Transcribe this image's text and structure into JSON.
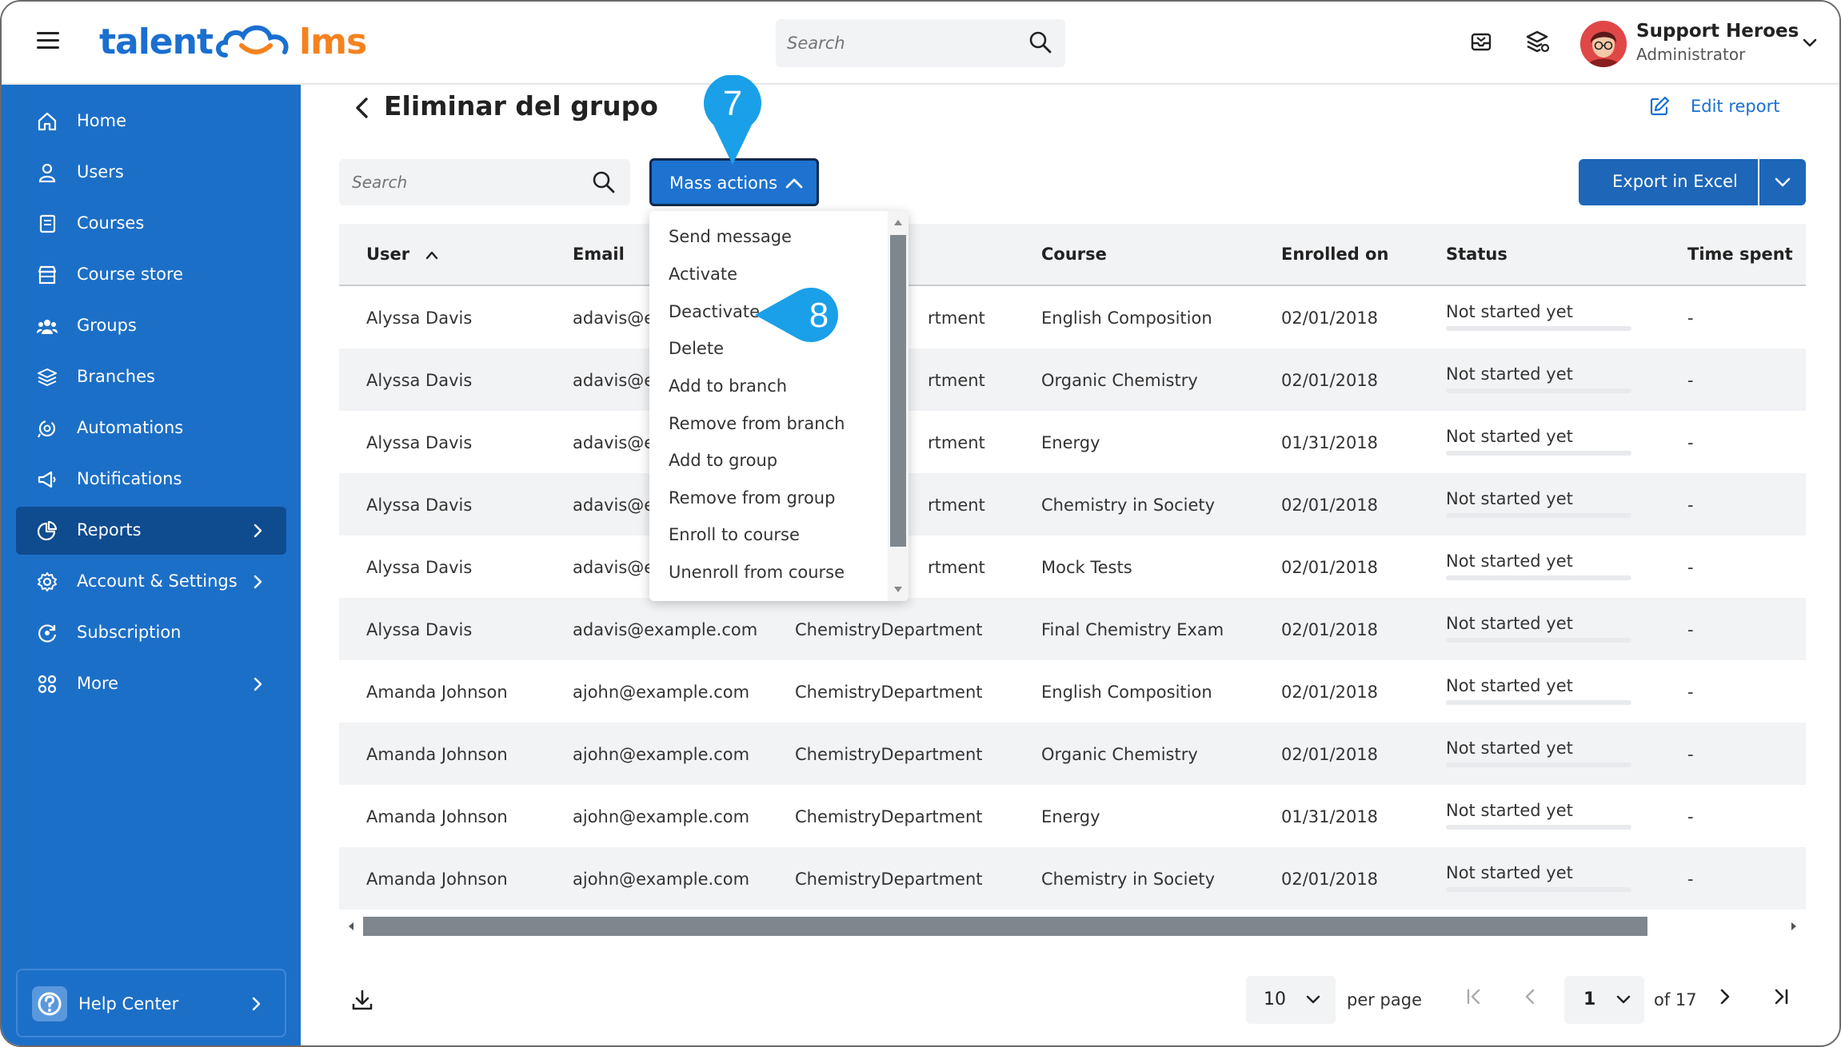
{
  "brand": {
    "logo_left": "talent",
    "logo_right": "lms",
    "primary": "#1c6fc7",
    "accent": "#f5821f",
    "callout": "#1aa0e8"
  },
  "header": {
    "menu_icon": "hamburger-icon",
    "search_placeholder": "Search",
    "icons": [
      "inbox-icon",
      "layers-settings-icon"
    ],
    "user_name": "Support Heroes",
    "user_role": "Administrator"
  },
  "sidebar": {
    "items": [
      {
        "label": "Home",
        "icon": "home-icon"
      },
      {
        "label": "Users",
        "icon": "user-icon"
      },
      {
        "label": "Courses",
        "icon": "book-icon"
      },
      {
        "label": "Course store",
        "icon": "store-icon"
      },
      {
        "label": "Groups",
        "icon": "groups-icon"
      },
      {
        "label": "Branches",
        "icon": "layers-icon"
      },
      {
        "label": "Automations",
        "icon": "automation-icon"
      },
      {
        "label": "Notifications",
        "icon": "megaphone-icon"
      },
      {
        "label": "Reports",
        "icon": "pie-chart-icon",
        "active": true
      },
      {
        "label": "Account & Settings",
        "icon": "gear-icon"
      },
      {
        "label": "Subscription",
        "icon": "subscription-icon"
      },
      {
        "label": "More",
        "icon": "grid-icon"
      }
    ],
    "help_label": "Help Center"
  },
  "page": {
    "title": "Eliminar del grupo",
    "edit_report": "Edit report",
    "search_placeholder": "Search",
    "mass_actions": "Mass actions",
    "export_label": "Export in Excel"
  },
  "table": {
    "columns": [
      "User",
      "Email",
      "Course",
      "Enrolled on",
      "Status",
      "Time spent"
    ],
    "rows": [
      {
        "user": "Alyssa Davis",
        "email": "adavis@e",
        "branch": "rtment",
        "course": "English Composition",
        "enrolled": "02/01/2018",
        "status": "Not started yet",
        "time": "-"
      },
      {
        "user": "Alyssa Davis",
        "email": "adavis@e",
        "branch": "rtment",
        "course": "Organic Chemistry",
        "enrolled": "02/01/2018",
        "status": "Not started yet",
        "time": "-"
      },
      {
        "user": "Alyssa Davis",
        "email": "adavis@e",
        "branch": "rtment",
        "course": "Energy",
        "enrolled": "01/31/2018",
        "status": "Not started yet",
        "time": "-"
      },
      {
        "user": "Alyssa Davis",
        "email": "adavis@e",
        "branch": "rtment",
        "course": "Chemistry in Society",
        "enrolled": "02/01/2018",
        "status": "Not started yet",
        "time": "-"
      },
      {
        "user": "Alyssa Davis",
        "email": "adavis@e",
        "branch": "rtment",
        "course": "Mock Tests",
        "enrolled": "02/01/2018",
        "status": "Not started yet",
        "time": "-"
      },
      {
        "user": "Alyssa Davis",
        "email": "adavis@example.com",
        "branch": "ChemistryDepartment",
        "course": "Final Chemistry Exam",
        "enrolled": "02/01/2018",
        "status": "Not started yet",
        "time": "-"
      },
      {
        "user": "Amanda Johnson",
        "email": "ajohn@example.com",
        "branch": "ChemistryDepartment",
        "course": "English Composition",
        "enrolled": "02/01/2018",
        "status": "Not started yet",
        "time": "-"
      },
      {
        "user": "Amanda Johnson",
        "email": "ajohn@example.com",
        "branch": "ChemistryDepartment",
        "course": "Organic Chemistry",
        "enrolled": "02/01/2018",
        "status": "Not started yet",
        "time": "-"
      },
      {
        "user": "Amanda Johnson",
        "email": "ajohn@example.com",
        "branch": "ChemistryDepartment",
        "course": "Energy",
        "enrolled": "01/31/2018",
        "status": "Not started yet",
        "time": "-"
      },
      {
        "user": "Amanda Johnson",
        "email": "ajohn@example.com",
        "branch": "ChemistryDepartment",
        "course": "Chemistry in Society",
        "enrolled": "02/01/2018",
        "status": "Not started yet",
        "time": "-"
      }
    ]
  },
  "mass_menu": {
    "items": [
      "Send message",
      "Activate",
      "Deactivate",
      "Delete",
      "Add to branch",
      "Remove from branch",
      "Add to group",
      "Remove from group",
      "Enroll to course",
      "Unenroll from course"
    ]
  },
  "pagination": {
    "per_page_value": "10",
    "per_page_label": "per page",
    "current_page": "1",
    "of_label": "of 17"
  },
  "callouts": {
    "step7": "7",
    "step8": "8"
  }
}
